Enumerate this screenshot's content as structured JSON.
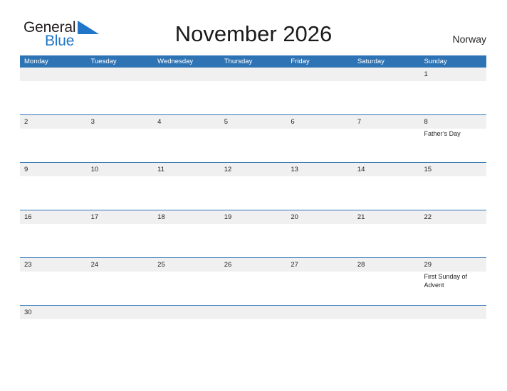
{
  "brand": {
    "name_part1": "General",
    "name_part2": "Blue",
    "flag_color": "#2176c7",
    "text_color": "#231f20"
  },
  "header": {
    "title": "November 2026",
    "country": "Norway"
  },
  "theme": {
    "header_blue": "#2e74b5",
    "band_gray": "#f0f0f0",
    "text_dark": "#231f20",
    "row_divider": "#2e74b5"
  },
  "calendar": {
    "month": "November",
    "year": "2026",
    "weekday_headers": [
      "Monday",
      "Tuesday",
      "Wednesday",
      "Thursday",
      "Friday",
      "Saturday",
      "Sunday"
    ],
    "weeks": [
      {
        "short": false,
        "days": [
          {
            "num": "",
            "events": []
          },
          {
            "num": "",
            "events": []
          },
          {
            "num": "",
            "events": []
          },
          {
            "num": "",
            "events": []
          },
          {
            "num": "",
            "events": []
          },
          {
            "num": "",
            "events": []
          },
          {
            "num": "1",
            "events": []
          }
        ]
      },
      {
        "short": false,
        "days": [
          {
            "num": "2",
            "events": []
          },
          {
            "num": "3",
            "events": []
          },
          {
            "num": "4",
            "events": []
          },
          {
            "num": "5",
            "events": []
          },
          {
            "num": "6",
            "events": []
          },
          {
            "num": "7",
            "events": []
          },
          {
            "num": "8",
            "events": [
              "Father’s Day"
            ]
          }
        ]
      },
      {
        "short": false,
        "days": [
          {
            "num": "9",
            "events": []
          },
          {
            "num": "10",
            "events": []
          },
          {
            "num": "11",
            "events": []
          },
          {
            "num": "12",
            "events": []
          },
          {
            "num": "13",
            "events": []
          },
          {
            "num": "14",
            "events": []
          },
          {
            "num": "15",
            "events": []
          }
        ]
      },
      {
        "short": false,
        "days": [
          {
            "num": "16",
            "events": []
          },
          {
            "num": "17",
            "events": []
          },
          {
            "num": "18",
            "events": []
          },
          {
            "num": "19",
            "events": []
          },
          {
            "num": "20",
            "events": []
          },
          {
            "num": "21",
            "events": []
          },
          {
            "num": "22",
            "events": []
          }
        ]
      },
      {
        "short": false,
        "days": [
          {
            "num": "23",
            "events": []
          },
          {
            "num": "24",
            "events": []
          },
          {
            "num": "25",
            "events": []
          },
          {
            "num": "26",
            "events": []
          },
          {
            "num": "27",
            "events": []
          },
          {
            "num": "28",
            "events": []
          },
          {
            "num": "29",
            "events": [
              "First Sunday of Advent"
            ]
          }
        ]
      },
      {
        "short": true,
        "days": [
          {
            "num": "30",
            "events": []
          },
          {
            "num": "",
            "events": []
          },
          {
            "num": "",
            "events": []
          },
          {
            "num": "",
            "events": []
          },
          {
            "num": "",
            "events": []
          },
          {
            "num": "",
            "events": []
          },
          {
            "num": "",
            "events": []
          }
        ]
      }
    ]
  }
}
